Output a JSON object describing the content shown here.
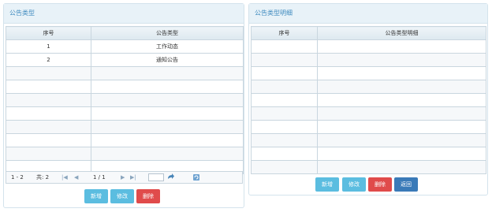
{
  "left_panel": {
    "title": "公告类型",
    "columns": [
      "序号",
      "公告类型"
    ],
    "rows": [
      {
        "index": "1",
        "type": "工作动态"
      },
      {
        "index": "2",
        "type": "通知公告"
      }
    ],
    "pager": {
      "range": "1 - 2",
      "total": "共: 2",
      "page": "1 / 1",
      "page_input": ""
    },
    "buttons": {
      "add": "新增",
      "edit": "修改",
      "delete": "删除"
    }
  },
  "right_panel": {
    "title": "公告类型明细",
    "columns": [
      "序号",
      "公告类型明细"
    ],
    "buttons": {
      "add": "新增",
      "edit": "修改",
      "delete": "删除",
      "back": "返回"
    }
  },
  "colors": {
    "accent": "#3f8bbf",
    "button_cyan": "#5bbde0",
    "button_red": "#e04b4b",
    "button_blue": "#3a7ab8"
  },
  "icons": {
    "pager": [
      "first-page-icon",
      "prev-page-icon",
      "next-page-icon",
      "last-page-icon",
      "go-icon",
      "refresh-icon"
    ]
  }
}
